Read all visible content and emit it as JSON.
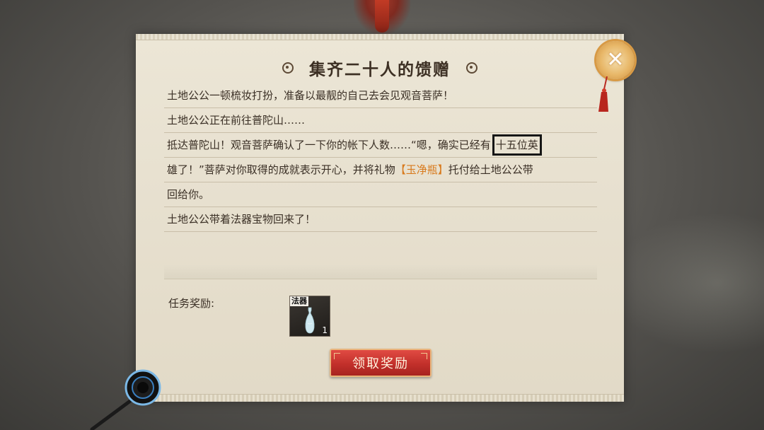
{
  "dialog": {
    "title": "集齐二十人的馈赠",
    "story": {
      "line1": "土地公公一顿梳妆打扮，准备以最靓的自己去会见观音菩萨！",
      "line2": "土地公公正在前往普陀山……",
      "line3_pre": "抵达普陀山！观音菩萨确认了一下你的帐下人数……“嗯，确实已经有",
      "line3_boxed": "十五位英",
      "line4_pre": "雄了！”菩萨对你取得的成就表示开心，并将礼物",
      "line4_item": "【玉净瓶】",
      "line4_post": "托付给土地公公带",
      "line5": "回给你。",
      "line6": "土地公公带着法器宝物回来了！"
    },
    "reward_label": "任务奖励:",
    "reward_item": {
      "tag": "法器",
      "count": "1",
      "icon": "jade-vase-icon"
    },
    "claim_button": "领取奖励",
    "close_icon": "close-icon"
  },
  "colors": {
    "highlight": "#d87a1d",
    "button_red": "#c2302b",
    "parchment": "#e7e0cf"
  }
}
